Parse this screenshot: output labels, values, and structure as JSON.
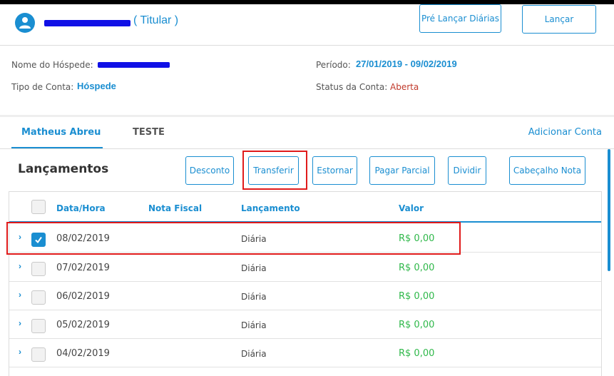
{
  "header": {
    "titular": "( Titular )",
    "pre_lancar_label": "Pré Lançar Diárias",
    "lancar_label": "Lançar"
  },
  "info": {
    "guest_label": "Nome do Hóspede:",
    "account_type_label": "Tipo de Conta:",
    "account_type_value": "Hóspede",
    "period_label": "Período:",
    "period_value": "27/01/2019 - 09/02/2019",
    "status_label": "Status da Conta:",
    "status_value": "Aberta",
    "status_color": "#c0392b"
  },
  "tabs": [
    {
      "label": "Matheus Abreu",
      "active": true
    },
    {
      "label": "TESTE",
      "active": false
    }
  ],
  "add_account_label": "Adicionar Conta",
  "section_title": "Lançamentos",
  "actions": {
    "desconto": "Desconto",
    "transferir": "Transferir",
    "estornar": "Estornar",
    "pagar_parcial": "Pagar Parcial",
    "dividir": "Dividir",
    "cabecalho_nota": "Cabeçalho Nota"
  },
  "table": {
    "columns": [
      "Data/Hora",
      "Nota Fiscal",
      "Lançamento",
      "Valor"
    ],
    "rows": [
      {
        "date": "08/02/2019",
        "nota": "",
        "lancamento": "Diária",
        "valor": "R$ 0,00",
        "checked": true
      },
      {
        "date": "07/02/2019",
        "nota": "",
        "lancamento": "Diária",
        "valor": "R$ 0,00",
        "checked": false
      },
      {
        "date": "06/02/2019",
        "nota": "",
        "lancamento": "Diária",
        "valor": "R$ 0,00",
        "checked": false
      },
      {
        "date": "05/02/2019",
        "nota": "",
        "lancamento": "Diária",
        "valor": "R$ 0,00",
        "checked": false
      },
      {
        "date": "04/02/2019",
        "nota": "",
        "lancamento": "Diária",
        "valor": "R$ 0,00",
        "checked": false
      }
    ]
  },
  "colors": {
    "accent": "#1a8ed1",
    "value_green": "#2fb84a",
    "highlight_red": "#e01b1b"
  }
}
